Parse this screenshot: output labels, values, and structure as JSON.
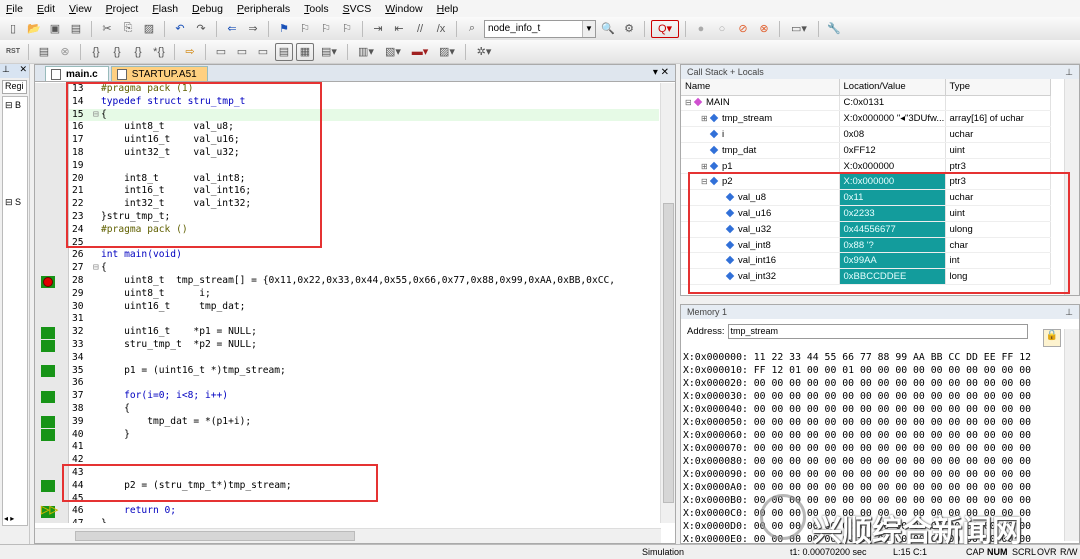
{
  "menu": [
    "File",
    "Edit",
    "View",
    "Project",
    "Flash",
    "Debug",
    "Peripherals",
    "Tools",
    "SVCS",
    "Window",
    "Help"
  ],
  "toolbar": {
    "target_combo": "node_info_t"
  },
  "left_pane": {
    "tab_label": "Regi",
    "tree_items": [
      "B",
      "S"
    ]
  },
  "editor": {
    "tabs": [
      {
        "label": "main.c",
        "active": true
      },
      {
        "label": "STARTUP.A51",
        "active": false
      }
    ],
    "close_glyph": "▾ ✕",
    "lines": [
      {
        "n": "13",
        "t": "#pragma pack (1)"
      },
      {
        "n": "14",
        "t": "typedef struct stru_tmp_t"
      },
      {
        "n": "15",
        "t": "{"
      },
      {
        "n": "16",
        "t": "    uint8_t     val_u8;"
      },
      {
        "n": "17",
        "t": "    uint16_t    val_u16;"
      },
      {
        "n": "18",
        "t": "    uint32_t    val_u32;"
      },
      {
        "n": "19",
        "t": ""
      },
      {
        "n": "20",
        "t": "    int8_t      val_int8;"
      },
      {
        "n": "21",
        "t": "    int16_t     val_int16;"
      },
      {
        "n": "22",
        "t": "    int32_t     val_int32;"
      },
      {
        "n": "23",
        "t": "}stru_tmp_t;"
      },
      {
        "n": "24",
        "t": "#pragma pack ()"
      },
      {
        "n": "25",
        "t": ""
      },
      {
        "n": "26",
        "t": "int main(void)"
      },
      {
        "n": "27",
        "t": "{"
      },
      {
        "n": "28",
        "t": "    uint8_t  tmp_stream[] = {0x11,0x22,0x33,0x44,0x55,0x66,0x77,0x88,0x99,0xAA,0xBB,0xCC,"
      },
      {
        "n": "29",
        "t": "    uint8_t      i;"
      },
      {
        "n": "30",
        "t": "    uint16_t     tmp_dat;"
      },
      {
        "n": "31",
        "t": ""
      },
      {
        "n": "32",
        "t": "    uint16_t    *p1 = NULL;"
      },
      {
        "n": "33",
        "t": "    stru_tmp_t  *p2 = NULL;"
      },
      {
        "n": "34",
        "t": ""
      },
      {
        "n": "35",
        "t": "    p1 = (uint16_t *)tmp_stream;"
      },
      {
        "n": "36",
        "t": ""
      },
      {
        "n": "37",
        "t": "    for(i=0; i<8; i++)"
      },
      {
        "n": "38",
        "t": "    {"
      },
      {
        "n": "39",
        "t": "        tmp_dat = *(p1+i);"
      },
      {
        "n": "40",
        "t": "    }"
      },
      {
        "n": "41",
        "t": ""
      },
      {
        "n": "42",
        "t": ""
      },
      {
        "n": "43",
        "t": ""
      },
      {
        "n": "44",
        "t": "    p2 = (stru_tmp_t*)tmp_stream;"
      },
      {
        "n": "45",
        "t": ""
      },
      {
        "n": "46",
        "t": "    return 0;"
      },
      {
        "n": "47",
        "t": "}"
      }
    ]
  },
  "call_stack": {
    "title": "Call Stack + Locals",
    "columns": [
      "Name",
      "Location/Value",
      "Type"
    ],
    "rows": [
      {
        "name": "MAIN",
        "value": "C:0x0131",
        "type": "",
        "level": 0,
        "exp": "⊟",
        "pink": true
      },
      {
        "name": "tmp_stream",
        "value": "X:0x000000 \"◂\"3DUfw...",
        "type": "array[16] of uchar",
        "level": 1,
        "exp": "⊞"
      },
      {
        "name": "i",
        "value": "0x08",
        "type": "uchar",
        "level": 1,
        "exp": ""
      },
      {
        "name": "tmp_dat",
        "value": "0xFF12",
        "type": "uint",
        "level": 1,
        "exp": ""
      },
      {
        "name": "p1",
        "value": "X:0x000000",
        "type": "ptr3",
        "level": 1,
        "exp": "⊞"
      },
      {
        "name": "p2",
        "value": "X:0x000000",
        "type": "ptr3",
        "level": 1,
        "exp": "⊟",
        "sel": true
      },
      {
        "name": "val_u8",
        "value": "0x11",
        "type": "uchar",
        "level": 2,
        "exp": "",
        "sel": true
      },
      {
        "name": "val_u16",
        "value": "0x2233",
        "type": "uint",
        "level": 2,
        "exp": "",
        "sel": true
      },
      {
        "name": "val_u32",
        "value": "0x44556677",
        "type": "ulong",
        "level": 2,
        "exp": "",
        "sel": true
      },
      {
        "name": "val_int8",
        "value": "0x88 '?",
        "type": "char",
        "level": 2,
        "exp": "",
        "sel": true
      },
      {
        "name": "val_int16",
        "value": "0x99AA",
        "type": "int",
        "level": 2,
        "exp": "",
        "sel": true
      },
      {
        "name": "val_int32",
        "value": "0xBBCCDDEE",
        "type": "long",
        "level": 2,
        "exp": "",
        "sel": true
      }
    ]
  },
  "memory": {
    "title": "Memory 1",
    "address_label": "Address:",
    "address_value": "tmp_stream",
    "lines": [
      "X:0x000000: 11 22 33 44 55 66 77 88 99 AA BB CC DD EE FF 12",
      "X:0x000010: FF 12 01 00 00 01 00 00 00 00 00 00 00 00 00 00",
      "X:0x000020: 00 00 00 00 00 00 00 00 00 00 00 00 00 00 00 00",
      "X:0x000030: 00 00 00 00 00 00 00 00 00 00 00 00 00 00 00 00",
      "X:0x000040: 00 00 00 00 00 00 00 00 00 00 00 00 00 00 00 00",
      "X:0x000050: 00 00 00 00 00 00 00 00 00 00 00 00 00 00 00 00",
      "X:0x000060: 00 00 00 00 00 00 00 00 00 00 00 00 00 00 00 00",
      "X:0x000070: 00 00 00 00 00 00 00 00 00 00 00 00 00 00 00 00",
      "X:0x000080: 00 00 00 00 00 00 00 00 00 00 00 00 00 00 00 00",
      "X:0x000090: 00 00 00 00 00 00 00 00 00 00 00 00 00 00 00 00",
      "X:0x0000A0: 00 00 00 00 00 00 00 00 00 00 00 00 00 00 00 00",
      "X:0x0000B0: 00 00 00 00 00 00 00 00 00 00 00 00 00 00 00 00",
      "X:0x0000C0: 00 00 00 00 00 00 00 00 00 00 00 00 00 00 00 00",
      "X:0x0000D0: 00 00 00 00 00 00 00 00 00 00 00 00 00 00 00 00",
      "X:0x0000E0: 00 00 00 00 00 00 00 00 00 00 00 00 00 00 00 00"
    ]
  },
  "status": {
    "mode": "Simulation",
    "time": "t1: 0.00070200 sec",
    "position": "L:15 C:1",
    "caps": "CAP",
    "num": "NUM",
    "scrl": "SCRL",
    "ovr": "OVR",
    "rw": "R/W"
  },
  "watermark": "兴顺综合新闻网",
  "colors": {
    "accent_select": "#139c9c",
    "red_box": "#e53232",
    "breakpoint": "#e00000",
    "coverage": "#179417"
  }
}
